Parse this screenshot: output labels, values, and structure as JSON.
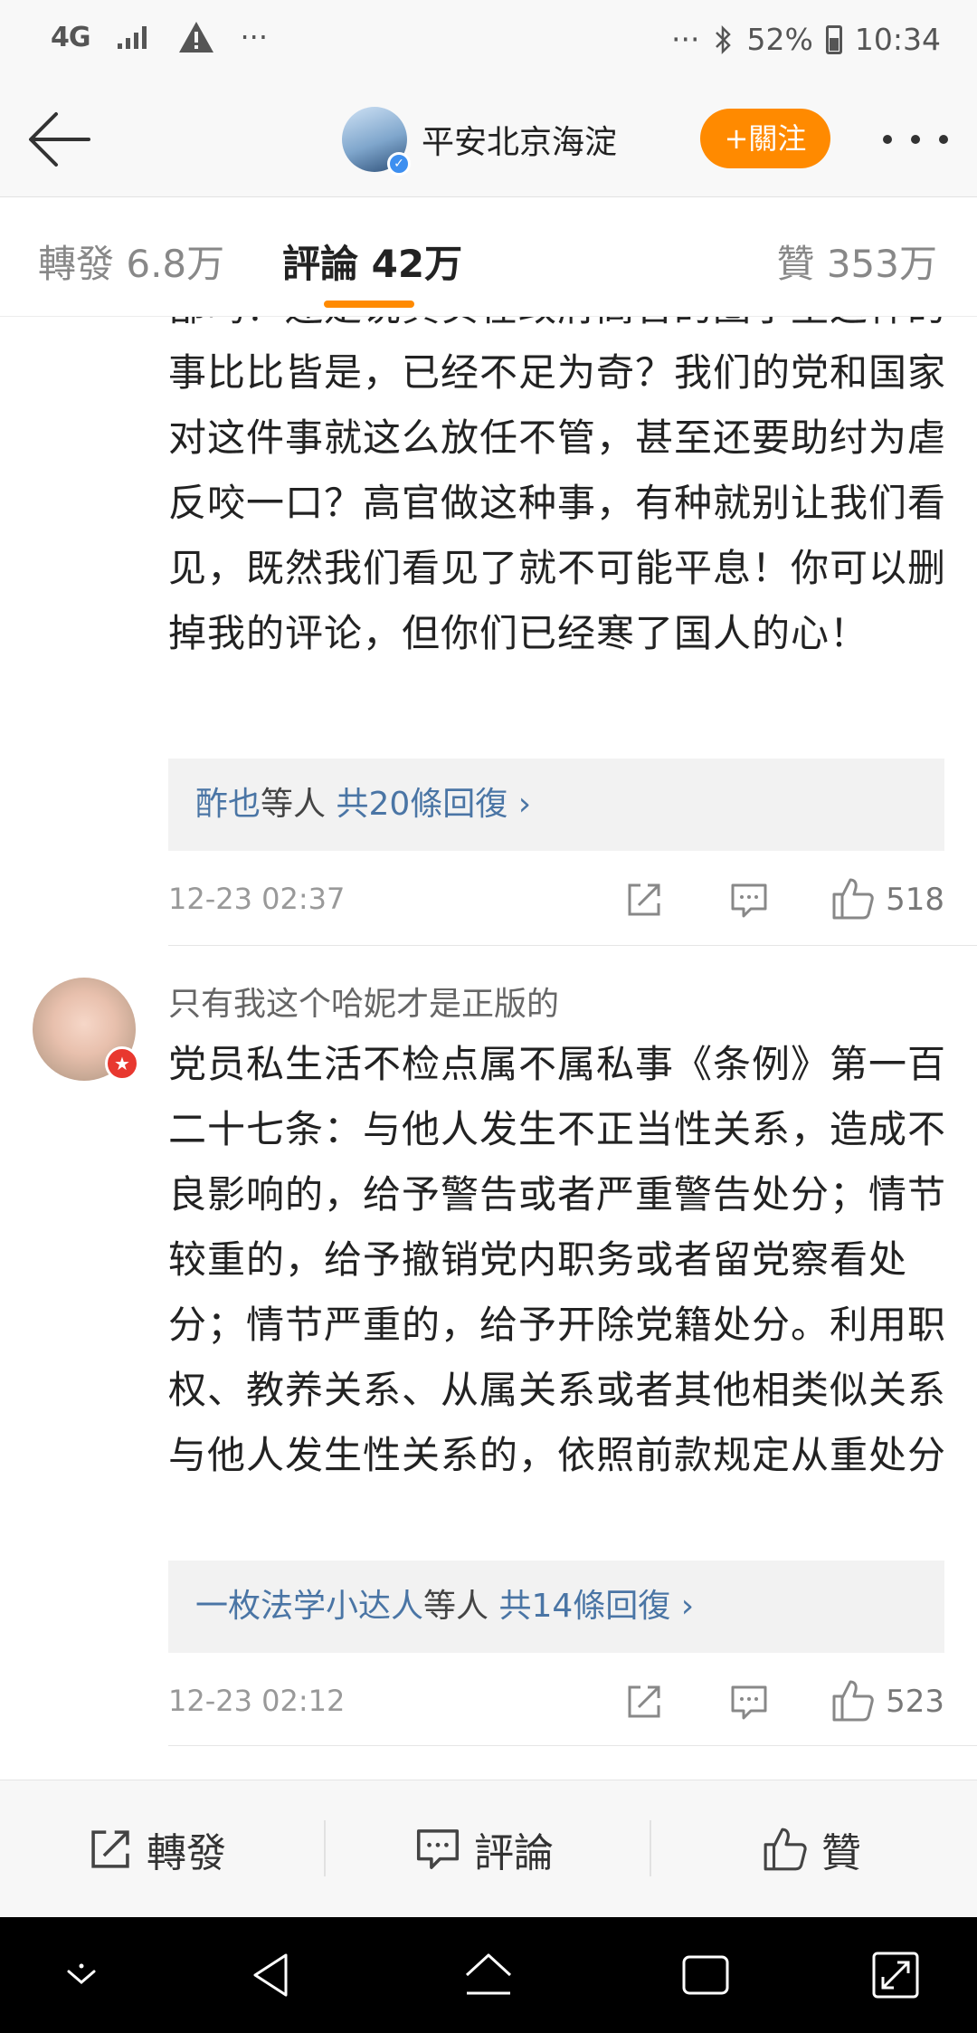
{
  "status_bar": {
    "network": "4G",
    "more": "···",
    "battery": "52%",
    "time": "10:34"
  },
  "header": {
    "account_name": "平安北京海淀",
    "follow_label": "+關注"
  },
  "tabs": {
    "reposts": "轉發 6.8万",
    "comments": "評論 42万",
    "likes": "贊 353万"
  },
  "comments": [
    {
      "text": "部吗？还是说真实在政府高官的圈子里这样的事比比皆是，已经不足为奇？我们的党和国家对这件事就这么放任不管，甚至还要助纣为虐反咬一口？高官做这种事，有种就别让我们看见，既然我们看见了就不可能平息！你可以删掉我的评论，但你们已经寒了国人的心！",
      "reply_user": "酢也",
      "reply_mid": "等人",
      "reply_count": "共20條回復 ›",
      "time": "12-23 02:37",
      "likes": "518"
    },
    {
      "username": "只有我这个哈妮才是正版的",
      "text": "党员私生活不检点属不属私事《条例》第一百二十七条：与他人发生不正当性关系，造成不良影响的，给予警告或者严重警告处分；情节较重的，给予撤销党内职务或者留党察看处分；情节严重的，给予开除党籍处分。利用职权、教养关系、从属关系或者其他相类似关系与他人发生性关系的，依照前款规定从重处分",
      "reply_user": "一枚法学小达人",
      "reply_mid": "等人",
      "reply_count": "共14條回復 ›",
      "time": "12-23 02:12",
      "likes": "523"
    }
  ],
  "action_bar": {
    "repost": "轉發",
    "comment": "評論",
    "like": "贊"
  },
  "icons": {
    "back": "arrow-left-icon",
    "share": "share-icon",
    "comment": "comment-icon",
    "like": "thumbs-up-icon"
  },
  "colors": {
    "accent": "#ff8a00",
    "link": "#4a75a5",
    "verified": "#3d8ff0"
  }
}
